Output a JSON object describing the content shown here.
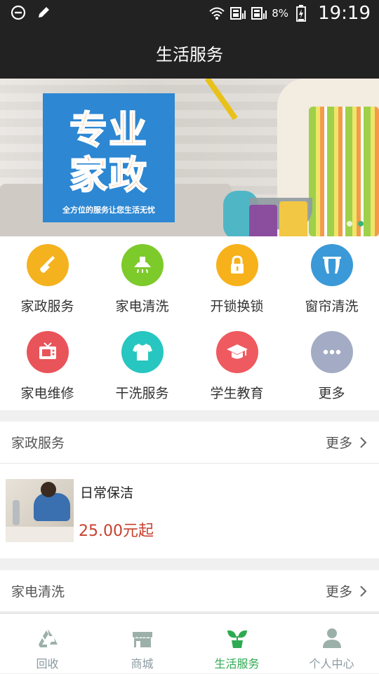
{
  "status_bar": {
    "battery": "8%",
    "time": "19:19"
  },
  "header": {
    "title": "生活服务"
  },
  "banner": {
    "headline_line1": "专业",
    "headline_line2": "家政",
    "tagline": "全方位的服务让您生活无忧",
    "slide_count": 2,
    "active_slide": 2
  },
  "services": [
    {
      "label": "家政服务",
      "icon": "broom-icon",
      "color": "#f5b21f"
    },
    {
      "label": "家电清洗",
      "icon": "range-hood-icon",
      "color": "#7dca2b"
    },
    {
      "label": "开锁换锁",
      "icon": "lock-icon",
      "color": "#f7b11a"
    },
    {
      "label": "窗帘清洗",
      "icon": "curtain-icon",
      "color": "#3b99d8"
    },
    {
      "label": "家电维修",
      "icon": "tv-repair-icon",
      "color": "#e9545a"
    },
    {
      "label": "干洗服务",
      "icon": "tshirt-icon",
      "color": "#27c6c0"
    },
    {
      "label": "学生教育",
      "icon": "graduation-cap-icon",
      "color": "#ee5a5f"
    },
    {
      "label": "更多",
      "icon": "more-dots-icon",
      "color": "#a3acc4"
    }
  ],
  "sections": [
    {
      "title": "家政服务",
      "more_label": "更多",
      "items": [
        {
          "name": "日常保洁",
          "price": "25.00元起"
        }
      ]
    },
    {
      "title": "家电清洗",
      "more_label": "更多"
    }
  ],
  "tabs": [
    {
      "label": "回收",
      "icon": "recycle-icon",
      "active": false
    },
    {
      "label": "商城",
      "icon": "shop-icon",
      "active": false
    },
    {
      "label": "生活服务",
      "icon": "sprout-icon",
      "active": true
    },
    {
      "label": "个人中心",
      "icon": "person-icon",
      "active": false
    }
  ],
  "colors": {
    "header_bg": "#222222",
    "accent_green": "#2eaa52",
    "price_red": "#c7402d",
    "tab_inactive": "#8a9aa0"
  }
}
